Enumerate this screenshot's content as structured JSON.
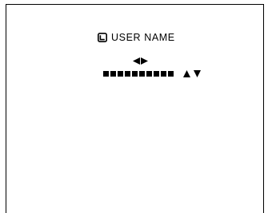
{
  "screen": {
    "title": "USER NAME",
    "title_icon": "menu-page-icon",
    "name_field": {
      "cell_count": 10,
      "cell_glyph": "■",
      "cursor_nav_icons": [
        "left-arrow-icon",
        "right-arrow-icon"
      ],
      "char_select_icons": [
        "up-arrow-icon",
        "down-arrow-icon"
      ]
    }
  }
}
